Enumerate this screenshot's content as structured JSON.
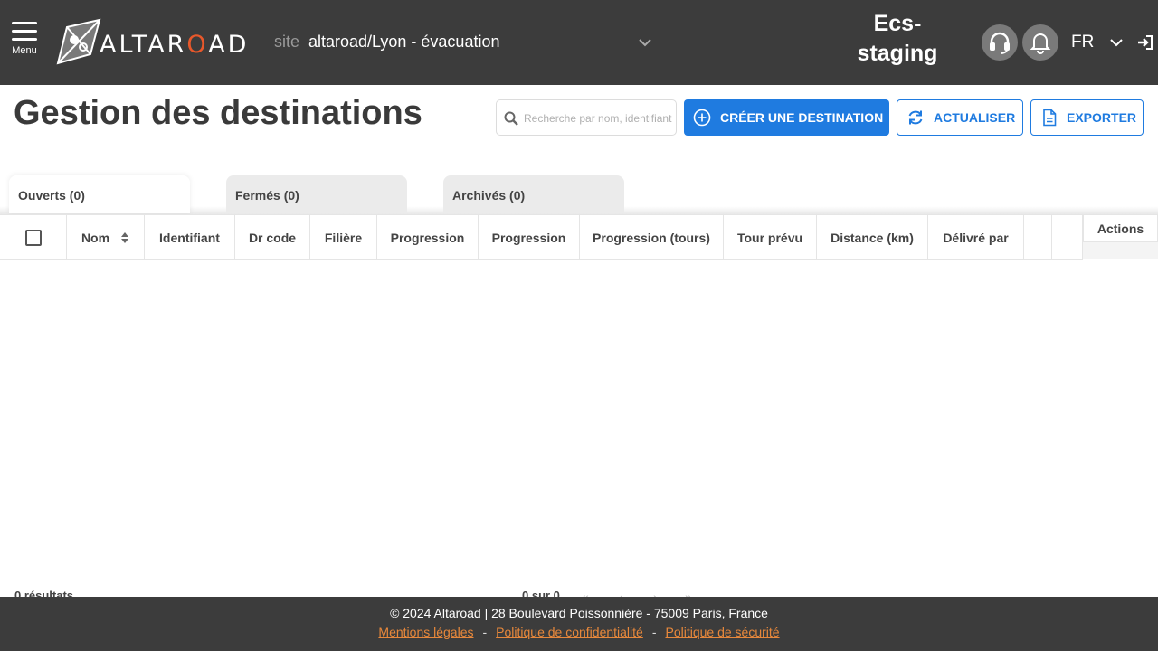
{
  "header": {
    "menu_label": "Menu",
    "logo_text_a": "ALTAR",
    "logo_text_o": "O",
    "logo_text_b": "AD",
    "site_prefix": "site",
    "site_value": "altaroad/Lyon - évacuation",
    "environment_line1": "Ecs-",
    "environment_line2": "staging",
    "language": "FR"
  },
  "page": {
    "title": "Gestion des destinations",
    "search_placeholder": "Recherche par nom, identifiant",
    "create_button": "CRÉER UNE DESTINATION",
    "refresh_button": "ACTUALISER",
    "export_button": "EXPORTER"
  },
  "tabs": [
    {
      "label": "Ouverts (0)",
      "active": true
    },
    {
      "label": "Fermés (0)",
      "active": false
    },
    {
      "label": "Archivés (0)",
      "active": false
    }
  ],
  "table": {
    "columns": [
      "Nom",
      "Identifiant",
      "Dr code",
      "Filière",
      "Progression",
      "Progression",
      "Progression (tours)",
      "Tour prévu",
      "Distance (km)",
      "Délivré par",
      "",
      ""
    ],
    "actions_header": "Actions",
    "rows": []
  },
  "pagination": {
    "results": "0 résultats",
    "page_info": "0 sur 0"
  },
  "footer": {
    "copyright": "© 2024 Altaroad | 28 Boulevard Poissonnière - 75009 Paris, France",
    "links": [
      "Mentions légales",
      "Politique de confidentialité",
      "Politique de sécurité"
    ],
    "separator": "-"
  },
  "colors": {
    "header_bg": "#3c3c3c",
    "primary": "#1f7be0",
    "accent_orange": "#e8582b",
    "footer_link": "#e8883b"
  }
}
